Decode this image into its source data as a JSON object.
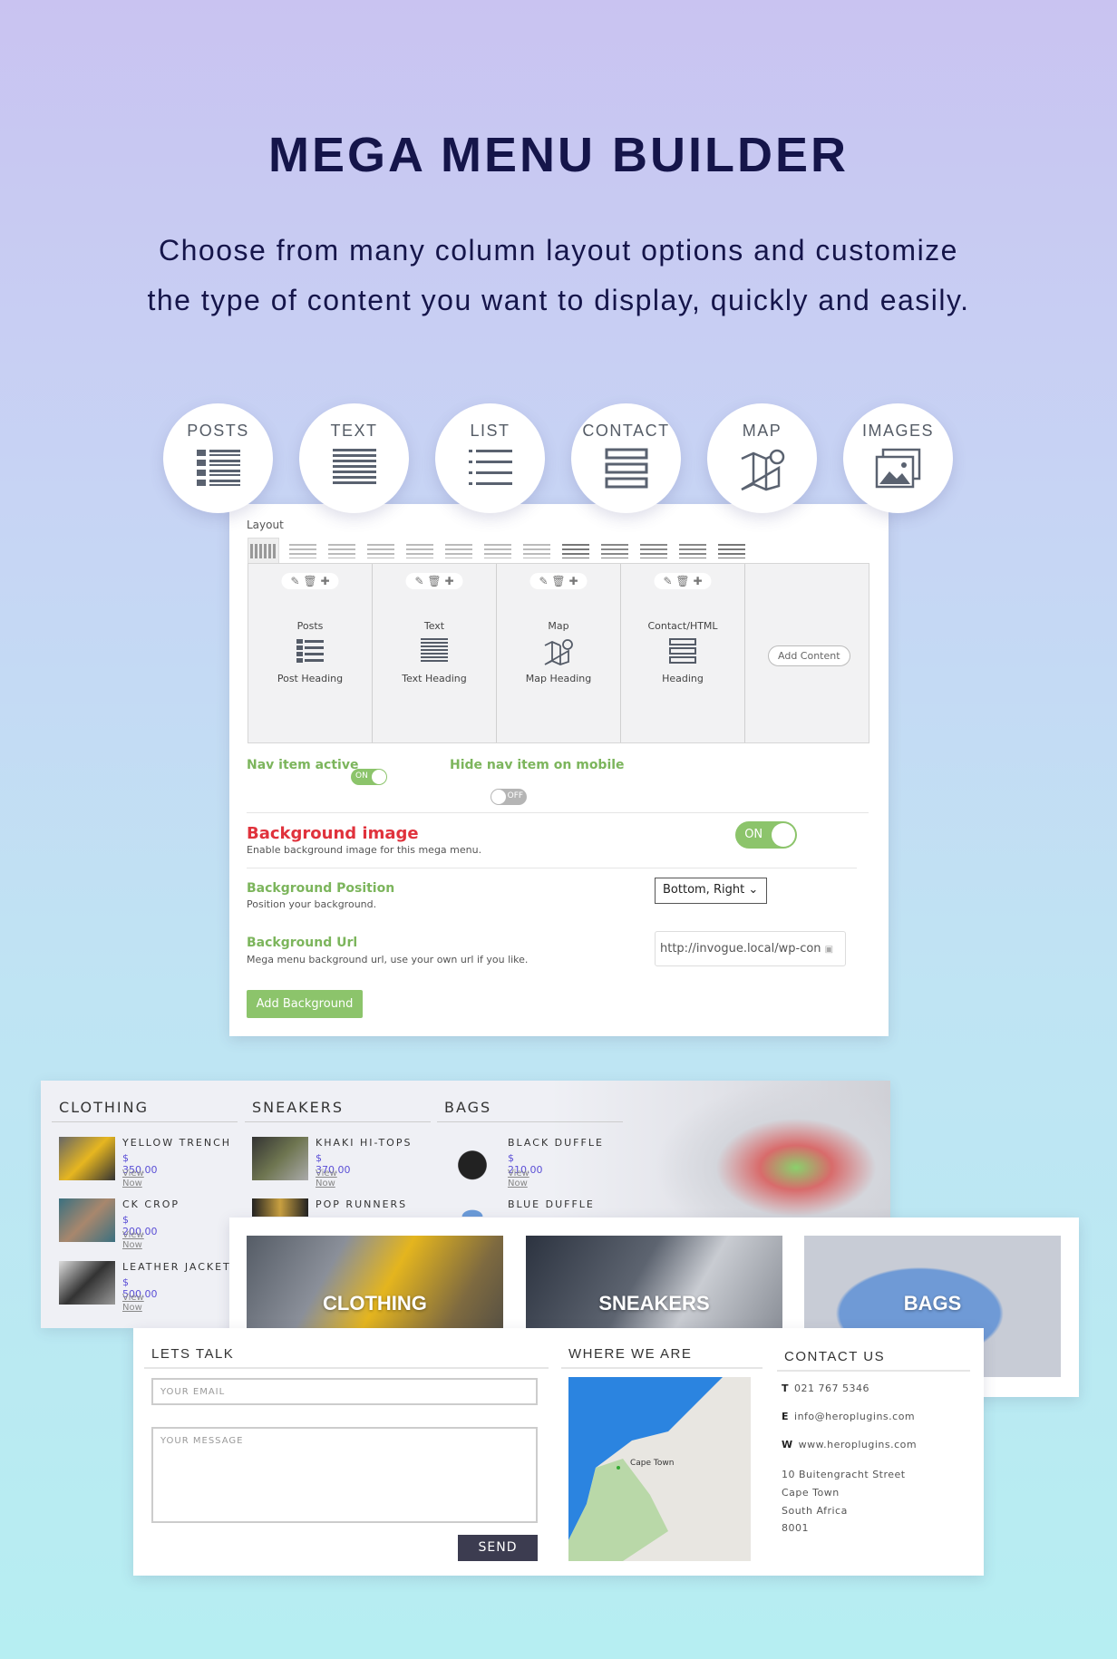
{
  "hero": {
    "title": "MEGA MENU BUILDER",
    "subtitle_line1": "Choose from many column layout options and customize",
    "subtitle_line2": "the type of content you want to display, quickly and easily."
  },
  "content_types": [
    {
      "label": "POSTS",
      "icon": "posts-list-icon"
    },
    {
      "label": "TEXT",
      "icon": "text-lines-icon"
    },
    {
      "label": "LIST",
      "icon": "list-icon"
    },
    {
      "label": "CONTACT",
      "icon": "contact-form-icon"
    },
    {
      "label": "MAP",
      "icon": "map-icon"
    },
    {
      "label": "IMAGES",
      "icon": "images-icon"
    }
  ],
  "builder": {
    "layout_label": "Layout",
    "columns": [
      {
        "type": "Posts",
        "heading": "Post Heading"
      },
      {
        "type": "Text",
        "heading": "Text Heading"
      },
      {
        "type": "Map",
        "heading": "Map Heading"
      },
      {
        "type": "Contact/HTML",
        "heading": "Heading"
      }
    ],
    "add_content": "Add Content",
    "nav_active_label": "Nav item active",
    "nav_active_toggle": "ON",
    "hide_mobile_label": "Hide nav item on mobile",
    "hide_mobile_toggle": "OFF",
    "bg_image_title": "Background image",
    "bg_image_desc": "Enable background image for this mega menu.",
    "bg_image_toggle": "ON",
    "bg_position_title": "Background Position",
    "bg_position_desc": "Position your background.",
    "bg_position_value": "Bottom, Right",
    "bg_url_title": "Background Url",
    "bg_url_desc": "Mega menu background url, use your own url if you like.",
    "bg_url_value": "http://invogue.local/wp-con",
    "add_background": "Add Background",
    "accent_green": "#8cc46b",
    "accent_red": "#e0323c"
  },
  "shop": {
    "columns": [
      {
        "title": "CLOTHING",
        "items": [
          {
            "name": "YELLOW TRENCH",
            "price": "$ 350.00",
            "link": "View Now"
          },
          {
            "name": "CK CROP",
            "price": "$ 200.00",
            "link": "View Now"
          },
          {
            "name": "LEATHER JACKET",
            "price": "$ 500.00",
            "link": "View Now"
          }
        ]
      },
      {
        "title": "SNEAKERS",
        "items": [
          {
            "name": "KHAKI HI-TOPS",
            "price": "$ 370.00",
            "link": "View Now"
          },
          {
            "name": "POP RUNNERS"
          }
        ]
      },
      {
        "title": "BAGS",
        "items": [
          {
            "name": "BLACK DUFFLE",
            "price": "$ 210.00",
            "link": "View Now"
          },
          {
            "name": "BLUE DUFFLE"
          }
        ]
      }
    ]
  },
  "categories": [
    "CLOTHING",
    "SNEAKERS",
    "BAGS"
  ],
  "contact": {
    "lets_talk": "LETS TALK",
    "email_placeholder": "YOUR EMAIL",
    "message_placeholder": "YOUR MESSAGE",
    "send": "SEND",
    "where": "WHERE WE ARE",
    "map_city": "Cape Town",
    "contact_us": "CONTACT US",
    "phone_key": "T",
    "phone": "021 767 5346",
    "email_key": "E",
    "email": "info@heroplugins.com",
    "web_key": "W",
    "web": "www.heroplugins.com",
    "address": [
      "10 Buitengracht Street",
      "Cape Town",
      "South Africa",
      "8001"
    ]
  }
}
